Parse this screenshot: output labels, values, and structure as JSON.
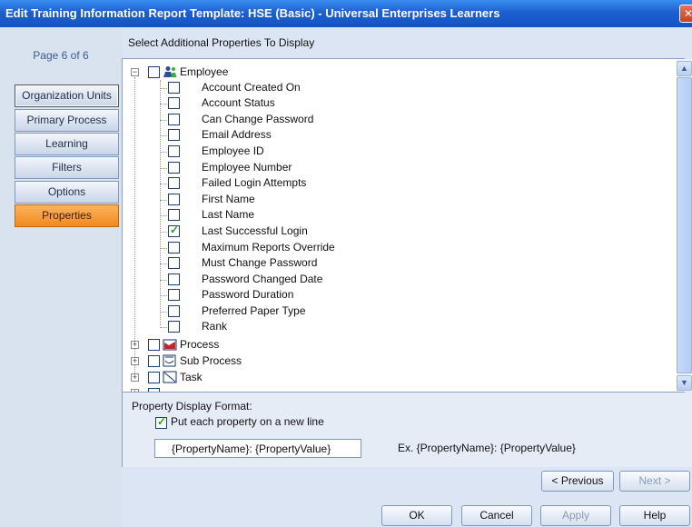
{
  "window": {
    "title": "Edit Training Information Report Template: HSE (Basic) - Universal Enterprises Learners",
    "close_glyph": "✕"
  },
  "left_nav": {
    "page_label": "Page 6 of 6",
    "items": [
      {
        "label": "Organization Units"
      },
      {
        "label": "Primary Process"
      },
      {
        "label": "Learning"
      },
      {
        "label": "Filters"
      },
      {
        "label": "Options"
      },
      {
        "label": "Properties",
        "active": true
      }
    ]
  },
  "main": {
    "header": "Select Additional Properties To Display",
    "tree": {
      "root": {
        "label": "Employee",
        "icon": "employee-icon",
        "expanded": true,
        "checked": false
      },
      "children": [
        {
          "label": "Account Created On",
          "checked": false
        },
        {
          "label": "Account Status",
          "checked": false
        },
        {
          "label": "Can Change Password",
          "checked": false
        },
        {
          "label": "Email Address",
          "checked": false
        },
        {
          "label": "Employee ID",
          "checked": false
        },
        {
          "label": "Employee Number",
          "checked": false
        },
        {
          "label": "Failed Login Attempts",
          "checked": false
        },
        {
          "label": "First Name",
          "checked": false
        },
        {
          "label": "Last Name",
          "checked": false
        },
        {
          "label": "Last Successful Login",
          "checked": true
        },
        {
          "label": "Maximum Reports Override",
          "checked": false
        },
        {
          "label": "Must Change Password",
          "checked": false
        },
        {
          "label": "Password Changed Date",
          "checked": false
        },
        {
          "label": "Password Duration",
          "checked": false
        },
        {
          "label": "Preferred Paper Type",
          "checked": false
        },
        {
          "label": "Rank",
          "checked": false
        }
      ],
      "siblings": [
        {
          "label": "Process",
          "icon": "process-icon"
        },
        {
          "label": "Sub Process",
          "icon": "sub-process-icon"
        },
        {
          "label": "Task",
          "icon": "task-icon"
        }
      ]
    },
    "format": {
      "label": "Property Display Format:",
      "newline_label": "Put each property on a new line",
      "newline_checked": true,
      "value": "{PropertyName}: {PropertyValue}",
      "example": "Ex. {PropertyName}: {PropertyValue}"
    }
  },
  "buttons": {
    "previous": "< Previous",
    "next": "Next >",
    "ok": "OK",
    "cancel": "Cancel",
    "apply": "Apply",
    "help": "Help"
  },
  "colors": {
    "titlebar": "#1d5fd0",
    "active_tab": "#f08a1e",
    "check": "#21a121"
  }
}
